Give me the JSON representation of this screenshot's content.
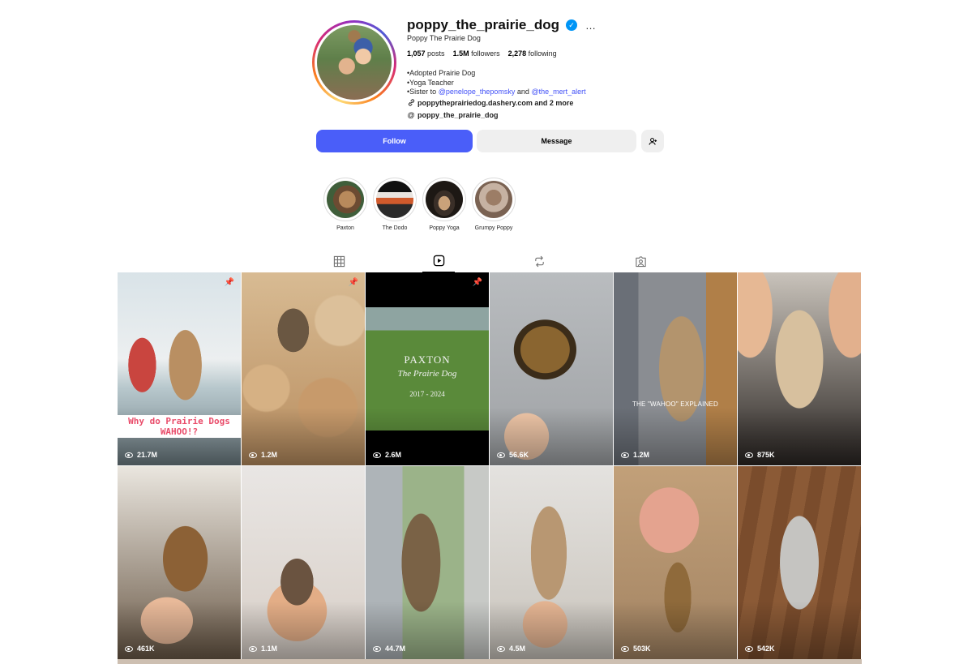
{
  "profile": {
    "username": "poppy_the_prairie_dog",
    "full_name": "Poppy The Prairie Dog",
    "more_icon": "…",
    "stats": {
      "posts_value": "1,057",
      "posts_label": "posts",
      "followers_value": "1.5M",
      "followers_label": "followers",
      "following_value": "2,278",
      "following_label": "following"
    },
    "bio": {
      "line1": "•Adopted Prairie Dog",
      "line2": "•Yoga Teacher",
      "line3_prefix": "•Sister to",
      "mention1": "@penelope_thepomsky",
      "line3_and": "and",
      "mention2": "@the_mert_alert",
      "link": "poppytheprairiedog.dashery.com and 2 more",
      "threads": "poppy_the_prairie_dog"
    }
  },
  "actions": {
    "follow_label": "Follow",
    "message_label": "Message"
  },
  "highlights": [
    {
      "label": "Paxton"
    },
    {
      "label": "The Dodo"
    },
    {
      "label": "Poppy Yoga"
    },
    {
      "label": "Grumpy Poppy"
    }
  ],
  "tabs": [
    {
      "name": "posts",
      "icon": "grid-icon"
    },
    {
      "name": "reels",
      "icon": "reels-icon",
      "active": true
    },
    {
      "name": "reposts",
      "icon": "repost-icon"
    },
    {
      "name": "tagged",
      "icon": "tagged-icon"
    }
  ],
  "reels": [
    {
      "views": "21.7M",
      "pinned": true,
      "overlay": "Why do Prairie Dogs WAHOO!?"
    },
    {
      "views": "1.2M",
      "pinned": true
    },
    {
      "views": "2.6M",
      "pinned": true,
      "overlay_title": "PAXTON",
      "overlay_sub": "The Prairie Dog",
      "overlay_years": "2017 - 2024"
    },
    {
      "views": "56.6K"
    },
    {
      "views": "1.2M",
      "overlay": "THE \"WAHOO\" EXPLAINED"
    },
    {
      "views": "875K"
    },
    {
      "views": "461K"
    },
    {
      "views": "1.1M"
    },
    {
      "views": "44.7M"
    },
    {
      "views": "4.5M"
    },
    {
      "views": "503K"
    },
    {
      "views": "542K"
    }
  ]
}
